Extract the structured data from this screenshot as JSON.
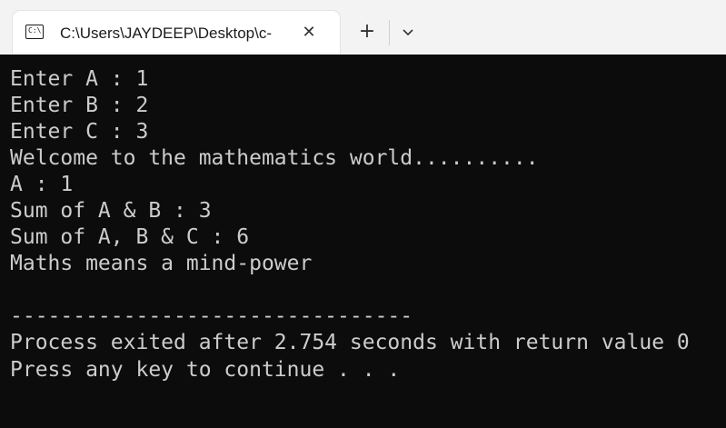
{
  "window": {
    "tab_title": "C:\\Users\\JAYDEEP\\Desktop\\c-",
    "tab_icon_text": "C:\\",
    "close_glyph": "✕",
    "new_tab_glyph": "+"
  },
  "console": {
    "lines": [
      "Enter A : 1",
      "Enter B : 2",
      "Enter C : 3",
      "Welcome to the mathematics world..........",
      "A : 1",
      "Sum of A & B : 3",
      "Sum of A, B & C : 6",
      "Maths means a mind-power",
      "",
      "--------------------------------",
      "Process exited after 2.754 seconds with return value 0",
      "Press any key to continue . . ."
    ]
  },
  "colors": {
    "terminal_bg": "#0c0c0c",
    "terminal_fg": "#cccccc",
    "titlebar_bg": "#f3f3f3",
    "tab_bg": "#ffffff"
  },
  "icons": {
    "tab_icon": "console-icon",
    "close": "close-icon",
    "new_tab": "plus-icon",
    "dropdown": "chevron-down-icon"
  }
}
